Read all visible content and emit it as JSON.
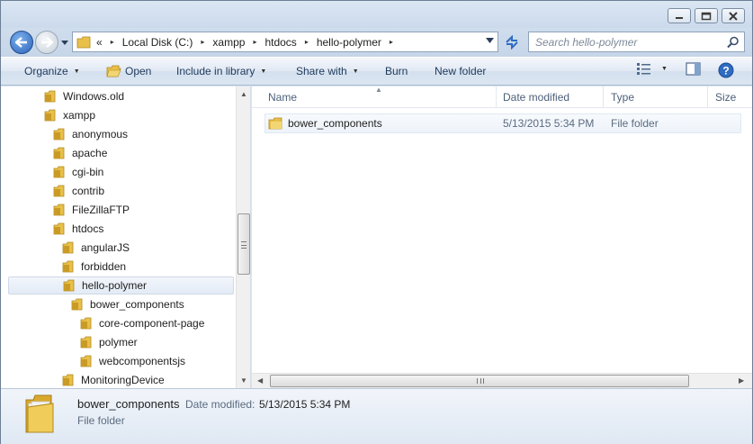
{
  "window": {
    "controls": [
      "minimize-icon",
      "maximize-icon",
      "close-icon"
    ]
  },
  "address": {
    "prefix": "«",
    "crumbs": [
      "Local Disk (C:)",
      "xampp",
      "htdocs",
      "hello-polymer"
    ],
    "search_placeholder": "Search hello-polymer"
  },
  "toolbar": {
    "organize": "Organize",
    "open": "Open",
    "include_in_library": "Include in library",
    "share_with": "Share with",
    "burn": "Burn",
    "new_folder": "New folder"
  },
  "nav_tree": [
    {
      "label": "Windows.old",
      "level": 0
    },
    {
      "label": "xampp",
      "level": 0
    },
    {
      "label": "anonymous",
      "level": 1
    },
    {
      "label": "apache",
      "level": 1
    },
    {
      "label": "cgi-bin",
      "level": 1
    },
    {
      "label": "contrib",
      "level": 1
    },
    {
      "label": "FileZillaFTP",
      "level": 1
    },
    {
      "label": "htdocs",
      "level": 1
    },
    {
      "label": "angularJS",
      "level": 2
    },
    {
      "label": "forbidden",
      "level": 2
    },
    {
      "label": "hello-polymer",
      "level": 2,
      "selected": true
    },
    {
      "label": "bower_components",
      "level": 3
    },
    {
      "label": "core-component-page",
      "level": 4
    },
    {
      "label": "polymer",
      "level": 4
    },
    {
      "label": "webcomponentsjs",
      "level": 4
    },
    {
      "label": "MonitoringDevice",
      "level": 2
    }
  ],
  "columns": {
    "name": "Name",
    "date_modified": "Date modified",
    "type": "Type",
    "size": "Size"
  },
  "files": [
    {
      "name": "bower_components",
      "date": "5/13/2015 5:34 PM",
      "type": "File folder"
    }
  ],
  "details": {
    "name": "bower_components",
    "date_label": "Date modified:",
    "date_value": "5/13/2015 5:34 PM",
    "type": "File folder"
  },
  "colors": {
    "folder": "#e8c04a",
    "accent": "#1e395b",
    "selection": "#e3ebf6"
  }
}
